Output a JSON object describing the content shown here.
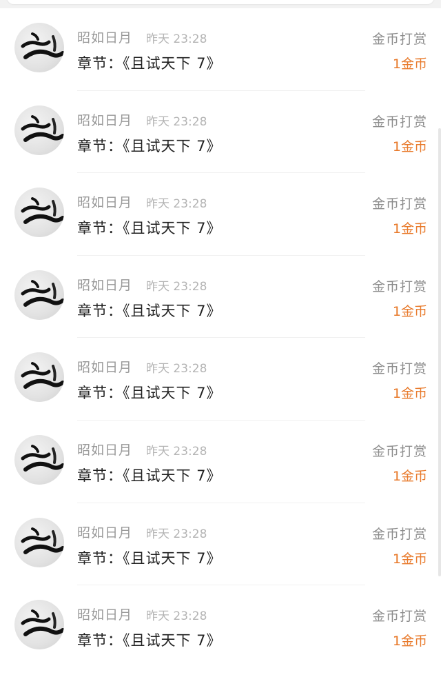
{
  "records": [
    {
      "name": "昭如日月",
      "time": "昨天 23:28",
      "chapter": "章节：《且试天下 7》",
      "type": "金币打赏",
      "amount": "1金币",
      "avatar_char": "之"
    },
    {
      "name": "昭如日月",
      "time": "昨天 23:28",
      "chapter": "章节：《且试天下 7》",
      "type": "金币打赏",
      "amount": "1金币",
      "avatar_char": "之"
    },
    {
      "name": "昭如日月",
      "time": "昨天 23:28",
      "chapter": "章节：《且试天下 7》",
      "type": "金币打赏",
      "amount": "1金币",
      "avatar_char": "之"
    },
    {
      "name": "昭如日月",
      "time": "昨天 23:28",
      "chapter": "章节：《且试天下 7》",
      "type": "金币打赏",
      "amount": "1金币",
      "avatar_char": "之"
    },
    {
      "name": "昭如日月",
      "time": "昨天 23:28",
      "chapter": "章节：《且试天下 7》",
      "type": "金币打赏",
      "amount": "1金币",
      "avatar_char": "之"
    },
    {
      "name": "昭如日月",
      "time": "昨天 23:28",
      "chapter": "章节：《且试天下 7》",
      "type": "金币打赏",
      "amount": "1金币",
      "avatar_char": "之"
    },
    {
      "name": "昭如日月",
      "time": "昨天 23:28",
      "chapter": "章节：《且试天下 7》",
      "type": "金币打赏",
      "amount": "1金币",
      "avatar_char": "之"
    },
    {
      "name": "昭如日月",
      "time": "昨天 23:28",
      "chapter": "章节：《且试天下 7》",
      "type": "金币打赏",
      "amount": "1金币",
      "avatar_char": "之"
    }
  ],
  "colors": {
    "amount": "#e8792a",
    "name": "#999999",
    "time": "#b4b4b4",
    "chapter": "#222222",
    "type": "#8d8d8d"
  }
}
